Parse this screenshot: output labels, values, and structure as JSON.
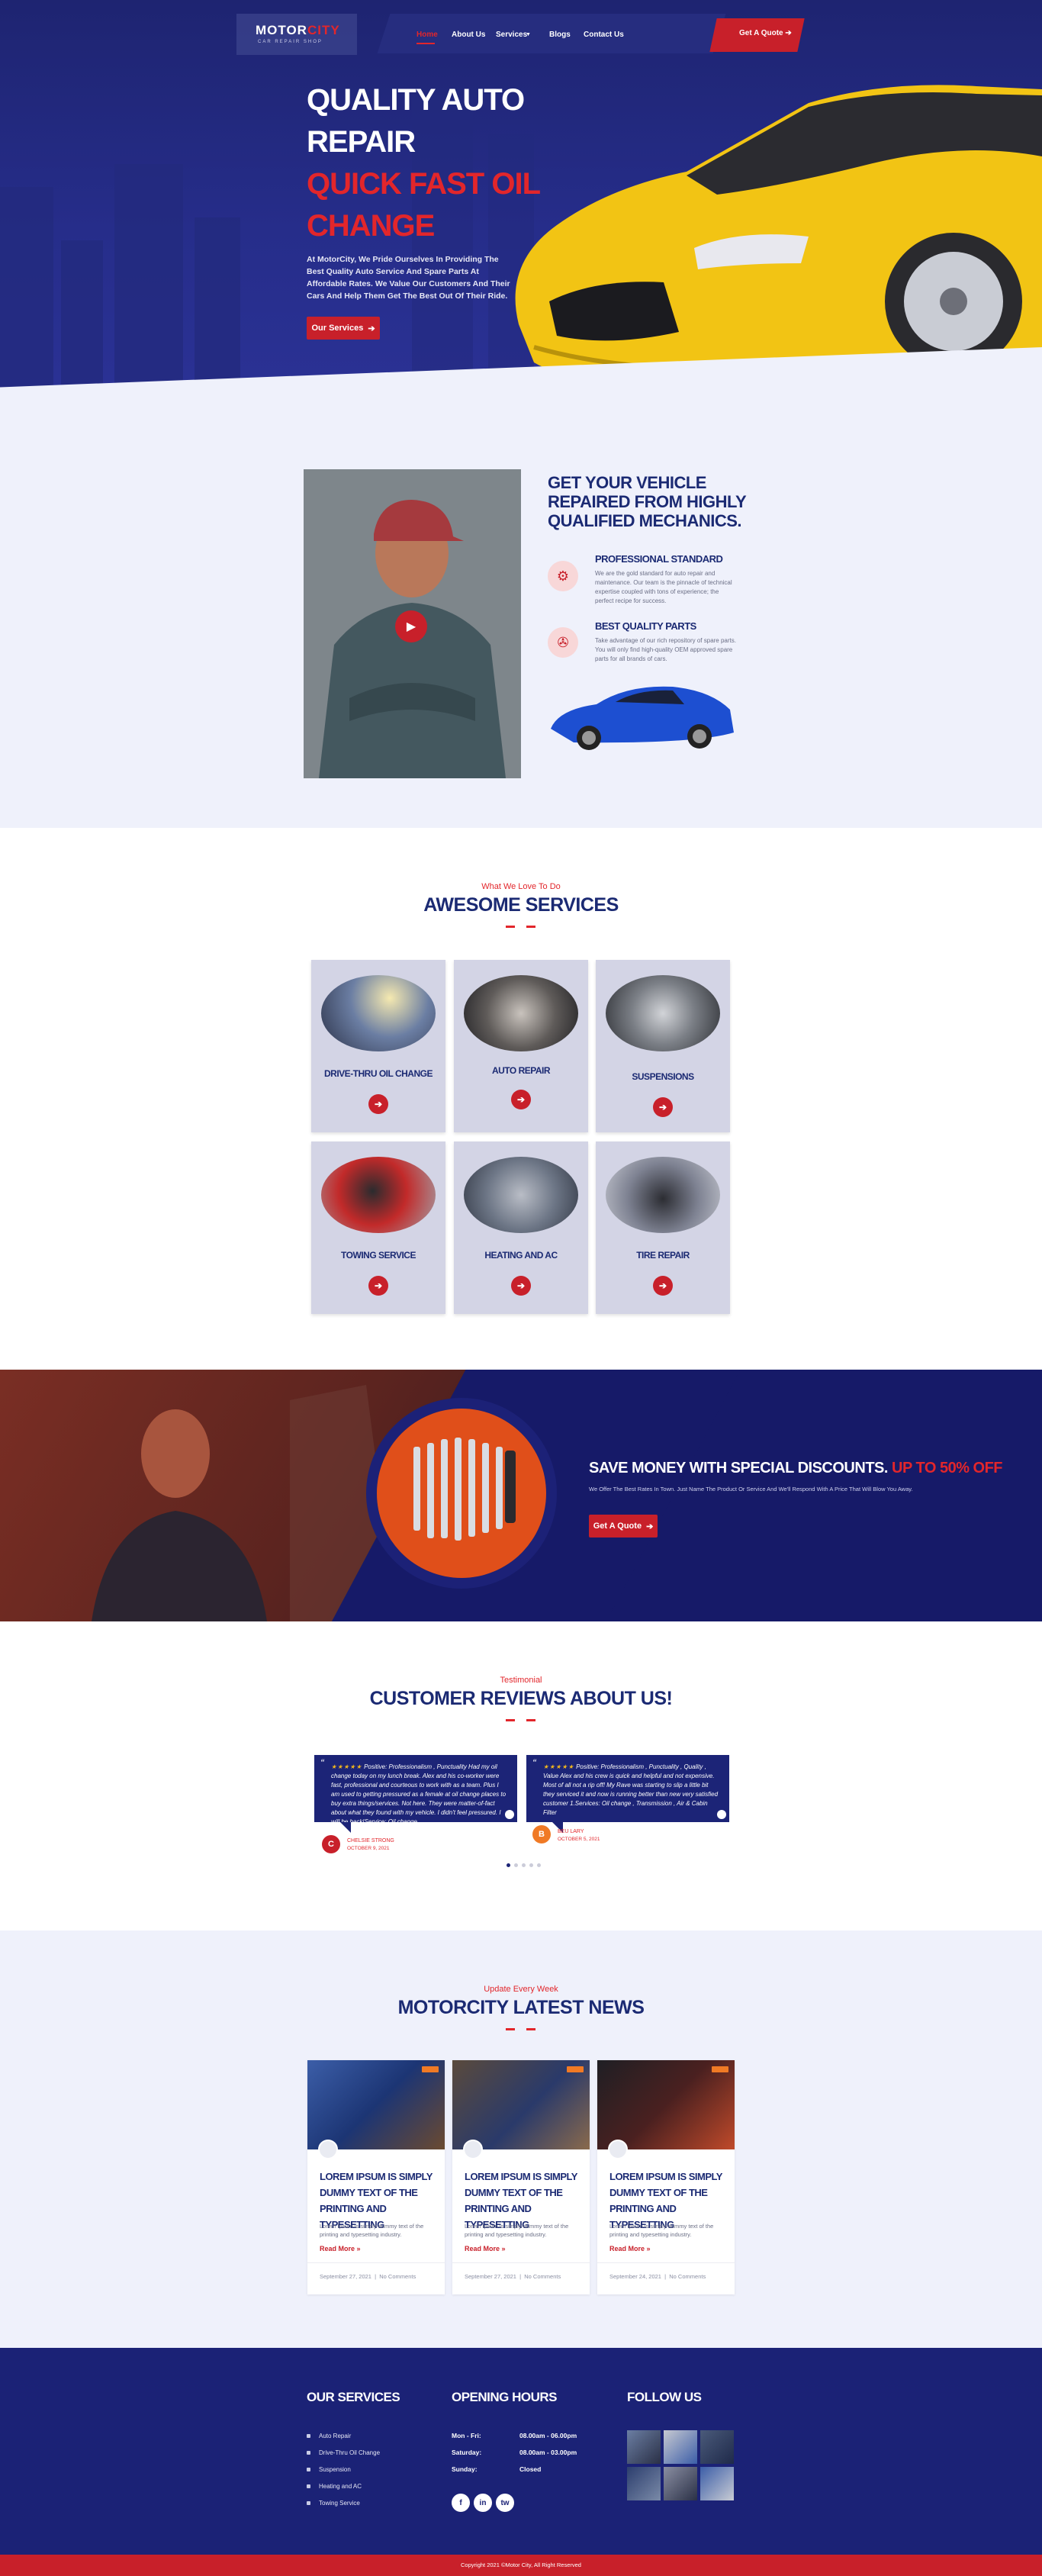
{
  "colors": {
    "brand_blue": "#1b2276",
    "accent_red": "#c8202a",
    "light_bg": "#eff1fb",
    "card_grey": "#d3d4e5"
  },
  "header": {
    "logo_main": "MOTOR",
    "logo_accent": "CITY",
    "logo_sub": "CAR REPAIR SHOP",
    "nav": [
      {
        "label": "Home",
        "active": true
      },
      {
        "label": "About Us"
      },
      {
        "label": "Services"
      },
      {
        "label": "Blogs"
      },
      {
        "label": "Contact Us"
      }
    ],
    "quote_button": "Get A Quote"
  },
  "hero": {
    "line1": "QUALITY AUTO",
    "line2": "REPAIR",
    "line3": "QUICK FAST OIL",
    "line4": "CHANGE",
    "description": "At MotorCity, We Pride Ourselves In Providing The Best Quality Auto Service And Spare Parts At Affordable Rates. We Value Our Customers And Their Cars And Help Them Get The Best Out Of Their Ride.",
    "button": "Our Services"
  },
  "about": {
    "title": "GET YOUR VEHICLE REPAIRED FROM HIGHLY QUALIFIED MECHANICS.",
    "features": [
      {
        "icon": "engine-icon",
        "title": "PROFESSIONAL STANDARD",
        "text": "We are the gold standard for auto repair and maintenance. Our team is the pinnacle of technical expertise coupled with tons of experience; the perfect recipe for success."
      },
      {
        "icon": "piston-icon",
        "title": "BEST QUALITY PARTS",
        "text": "Take advantage of our rich repository of spare parts. You will only find high-quality OEM approved spare parts for all brands of cars."
      }
    ]
  },
  "services": {
    "kicker": "What We Love To Do",
    "title": "AWESOME SERVICES",
    "items": [
      "DRIVE-THRU OIL CHANGE",
      "AUTO REPAIR",
      "SUSPENSIONS",
      "TOWING SERVICE",
      "HEATING AND AC",
      "TIRE REPAIR"
    ]
  },
  "discount": {
    "title": "SAVE MONEY WITH SPECIAL DISCOUNTS.",
    "highlight": "UP TO 50% OFF",
    "text": "We Offer The Best Rates In Town. Just Name The Product Or Service And We'll Respond With A Price That Will Blow You Away.",
    "button": "Get A Quote"
  },
  "testimonials": {
    "kicker": "Testimonial",
    "title": "CUSTOMER REVIEWS ABOUT US!",
    "reviews": [
      {
        "stars": "★★★★★",
        "text": "Positive: Professionalism , Punctuality Had my oil change today on my lunch break. Alex and his co-worker were fast, professional and courteous to work with as a team. Plus I am used to getting pressured as a female at oil change places to buy extra things/services. Not here. They were matter-of-fact about what they found with my vehicle. I didn't feel pressured. I will be back!Service: Oil change",
        "name": "CHELSIE STRONG",
        "date": "OCTOBER 9, 2021",
        "initial": "C",
        "avatar_color": "#c8202a"
      },
      {
        "stars": "★★★★★",
        "text": "Positive: Professionalism , Punctuality , Quality , Value Alex and his crew is quick and helpful and not expensive. Most of all not a rip off! My Rave was starting to slip a little bit they serviced it and now is running better than new very satisfied customer 1.Services: Oil change , Transmission , Air & Cabin Filter",
        "name": "BEU LARY",
        "date": "OCTOBER 5, 2021",
        "initial": "B",
        "avatar_color": "#f07a25"
      }
    ],
    "dots": 5
  },
  "news": {
    "kicker": "Update Every Week",
    "title": "MOTORCITY LATEST NEWS",
    "posts": [
      {
        "title": "LOREM IPSUM IS SIMPLY DUMMY TEXT OF THE PRINTING AND TYPESETTING",
        "excerpt": "Lorem Ipsum is simply dummy text of the printing and typesetting industry.",
        "more": "Read More »",
        "date": "September 27, 2021",
        "comments": "No Comments"
      },
      {
        "title": "LOREM IPSUM IS SIMPLY DUMMY TEXT OF THE PRINTING AND TYPESETTING",
        "excerpt": "Lorem Ipsum is simply dummy text of the printing and typesetting industry.",
        "more": "Read More »",
        "date": "September 27, 2021",
        "comments": "No Comments"
      },
      {
        "title": "LOREM IPSUM IS SIMPLY DUMMY TEXT OF THE PRINTING AND TYPESETTING",
        "excerpt": "Lorem Ipsum is simply dummy text of the printing and typesetting industry.",
        "more": "Read More »",
        "date": "September 24, 2021",
        "comments": "No Comments"
      }
    ]
  },
  "footer": {
    "services_title": "OUR SERVICES",
    "services": [
      "Auto Repair",
      "Drive-Thru Oil Change",
      "Suspension",
      "Heating and AC",
      "Towing Service"
    ],
    "hours_title": "OPENING HOURS",
    "hours": [
      {
        "day": "Mon - Fri:",
        "time": "08.00am - 06.00pm"
      },
      {
        "day": "Saturday:",
        "time": "08.00am - 03.00pm"
      },
      {
        "day": "Sunday:",
        "time": "Closed"
      }
    ],
    "social": [
      "f",
      "in",
      "tw"
    ],
    "follow_title": "FOLLOW US",
    "copyright": "Copyright 2021 ©Motor City, All Right Reserved"
  }
}
